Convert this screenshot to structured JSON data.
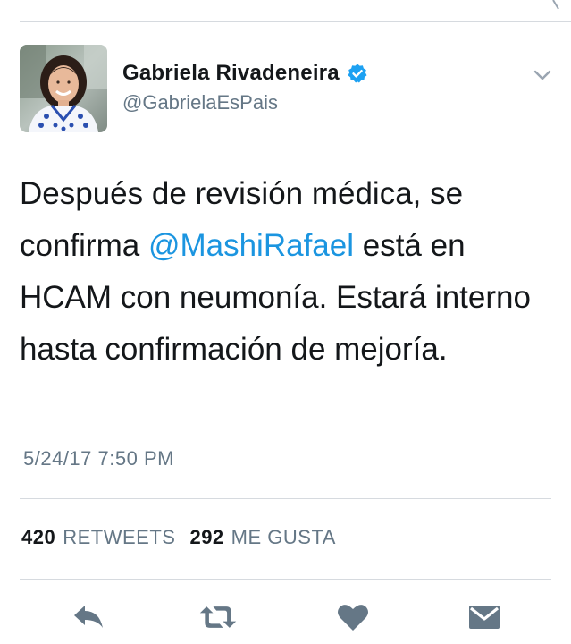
{
  "tweet": {
    "author": {
      "display_name": "Gabriela Rivadeneira",
      "handle": "@GabrielaEsPais",
      "verified": true,
      "avatar_icon": "profile-photo"
    },
    "text_parts": {
      "before_mention": "Después de revisión médica, se confirma ",
      "mention": "@MashiRafael",
      "after_mention": " está en HCAM con neumonía. Estará interno hasta confirmación de mejoría."
    },
    "timestamp": "5/24/17 7:50 PM",
    "stats": {
      "retweets_count": "420",
      "retweets_label": "RETWEETS",
      "likes_count": "292",
      "likes_label": "ME GUSTA"
    },
    "actions": {
      "reply_icon": "reply-icon",
      "retweet_icon": "retweet-icon",
      "like_icon": "heart-icon",
      "message_icon": "direct-message-icon"
    }
  },
  "colors": {
    "text_primary": "#14171a",
    "text_secondary": "#657786",
    "link": "#1b95e0",
    "divider": "#d6dadf",
    "icon": "#657786",
    "verified": "#1da1f2"
  }
}
